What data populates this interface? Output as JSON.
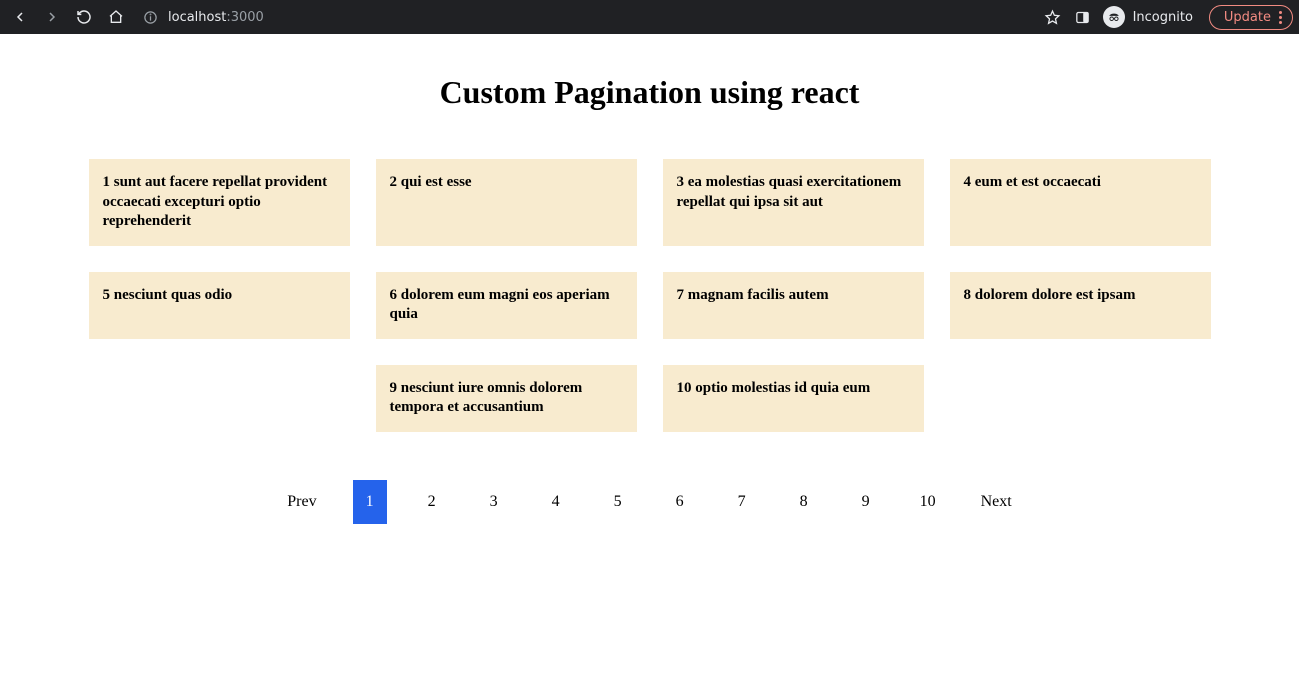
{
  "browser": {
    "url_host": "localhost",
    "url_port": ":3000",
    "incognito_label": "Incognito",
    "update_label": "Update"
  },
  "page": {
    "title": "Custom Pagination using react"
  },
  "cards": [
    {
      "id": 1,
      "text": "1 sunt aut facere repellat provident occaecati excepturi optio reprehenderit"
    },
    {
      "id": 2,
      "text": "2 qui est esse"
    },
    {
      "id": 3,
      "text": "3 ea molestias quasi exercitationem repellat qui ipsa sit aut"
    },
    {
      "id": 4,
      "text": "4 eum et est occaecati"
    },
    {
      "id": 5,
      "text": "5 nesciunt quas odio"
    },
    {
      "id": 6,
      "text": "6 dolorem eum magni eos aperiam quia"
    },
    {
      "id": 7,
      "text": "7 magnam facilis autem"
    },
    {
      "id": 8,
      "text": "8 dolorem dolore est ipsam"
    },
    {
      "id": 9,
      "text": "9 nesciunt iure omnis dolorem tempora et accusantium"
    },
    {
      "id": 10,
      "text": "10 optio molestias id quia eum"
    }
  ],
  "pagination": {
    "prev": "Prev",
    "next": "Next",
    "active": 1,
    "pages": [
      "1",
      "2",
      "3",
      "4",
      "5",
      "6",
      "7",
      "8",
      "9",
      "10"
    ]
  },
  "colors": {
    "card_bg": "#f8ebcf",
    "accent": "#2563eb",
    "chrome_bg": "#202124",
    "update": "#f28b82"
  }
}
